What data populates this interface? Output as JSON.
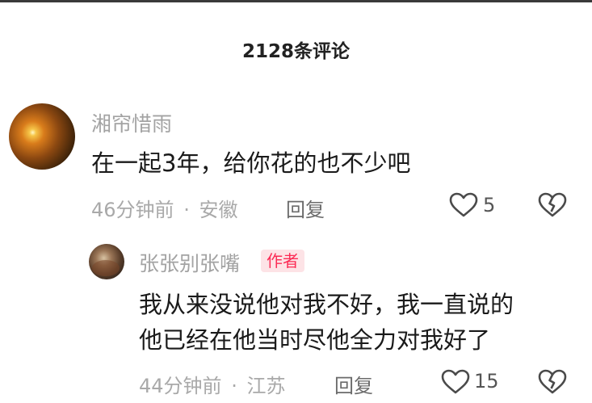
{
  "header": {
    "comment_count_title": "2128条评论"
  },
  "comments": [
    {
      "username": "湘帘惜雨",
      "text": "在一起3年，给你花的也不少吧",
      "time": "46分钟前",
      "separator": "·",
      "location": "安徽",
      "reply_label": "回复",
      "like_count": "5",
      "like_icon": "heart-outline-icon",
      "dislike_icon": "broken-heart-icon",
      "avatar_icon": "avatar-glowing-orb"
    }
  ],
  "replies": [
    {
      "username": "张张别张嘴",
      "badge": "作者",
      "text_lines": [
        "我从来没说他对我不好，我一直说的",
        "他已经在他当时尽他全力对我好了"
      ],
      "time": "44分钟前",
      "separator": "·",
      "location": "江苏",
      "reply_label": "回复",
      "like_count": "15",
      "like_icon": "heart-outline-icon",
      "dislike_icon": "broken-heart-icon"
    }
  ],
  "colors": {
    "badge_text": "#fc2b55",
    "badge_bg": "#fde3e6",
    "meta_text": "#a9a9a9",
    "body_text": "#1a1a1a"
  }
}
